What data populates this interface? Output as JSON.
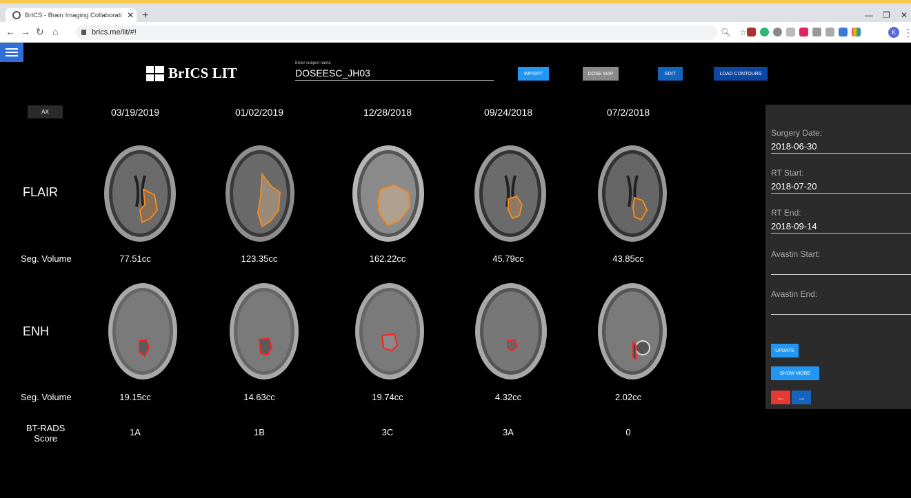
{
  "browser": {
    "tab_title": "BrICS - Brain Imaging Collaborati",
    "url": "brics.me/lit/#!",
    "profile_initial": "K"
  },
  "app": {
    "logo_text": "BrICS LIT",
    "subject_label": "Enter subject name",
    "subject_value": "DOSEESC_JH03",
    "buttons": {
      "import": "IMPORT",
      "dose_map": "DOSE MAP",
      "edit": "EDIT",
      "load_contours": "LOAD CONTOURS"
    },
    "view_button": "AX",
    "dates": [
      "03/19/2019",
      "01/02/2019",
      "12/28/2018",
      "09/24/2018",
      "07/2/2018"
    ],
    "row_labels": {
      "flair": "FLAIR",
      "enh": "ENH",
      "seg_volume": "Seg. Volume",
      "btrads_line1": "BT-RADS",
      "btrads_line2": "Score"
    },
    "flair_volumes": [
      "77.51cc",
      "123.35cc",
      "162.22cc",
      "45.79cc",
      "43.85cc"
    ],
    "enh_volumes": [
      "19.15cc",
      "14.63cc",
      "19.74cc",
      "4.32cc",
      "2.02cc"
    ],
    "btrads_scores": [
      "1A",
      "1B",
      "3C",
      "3A",
      "0"
    ],
    "colors": {
      "flair_contour": "#f08a24",
      "enh_contour": "#ff2020",
      "accent_blue": "#2196f3"
    }
  },
  "panel": {
    "surgery_date_label": "Surgery Date:",
    "surgery_date_value": "2018-06-30",
    "rt_start_label": "RT Start:",
    "rt_start_value": "2018-07-20",
    "rt_end_label": "RT End:",
    "rt_end_value": "2018-09-14",
    "avastin_start_label": "Avastin Start:",
    "avastin_start_value": "",
    "avastin_end_label": "Avastin End:",
    "avastin_end_value": "",
    "update_label": "UPDATE",
    "show_more_label": "SHOW MORE",
    "prev_label": "←",
    "next_label": "→"
  }
}
